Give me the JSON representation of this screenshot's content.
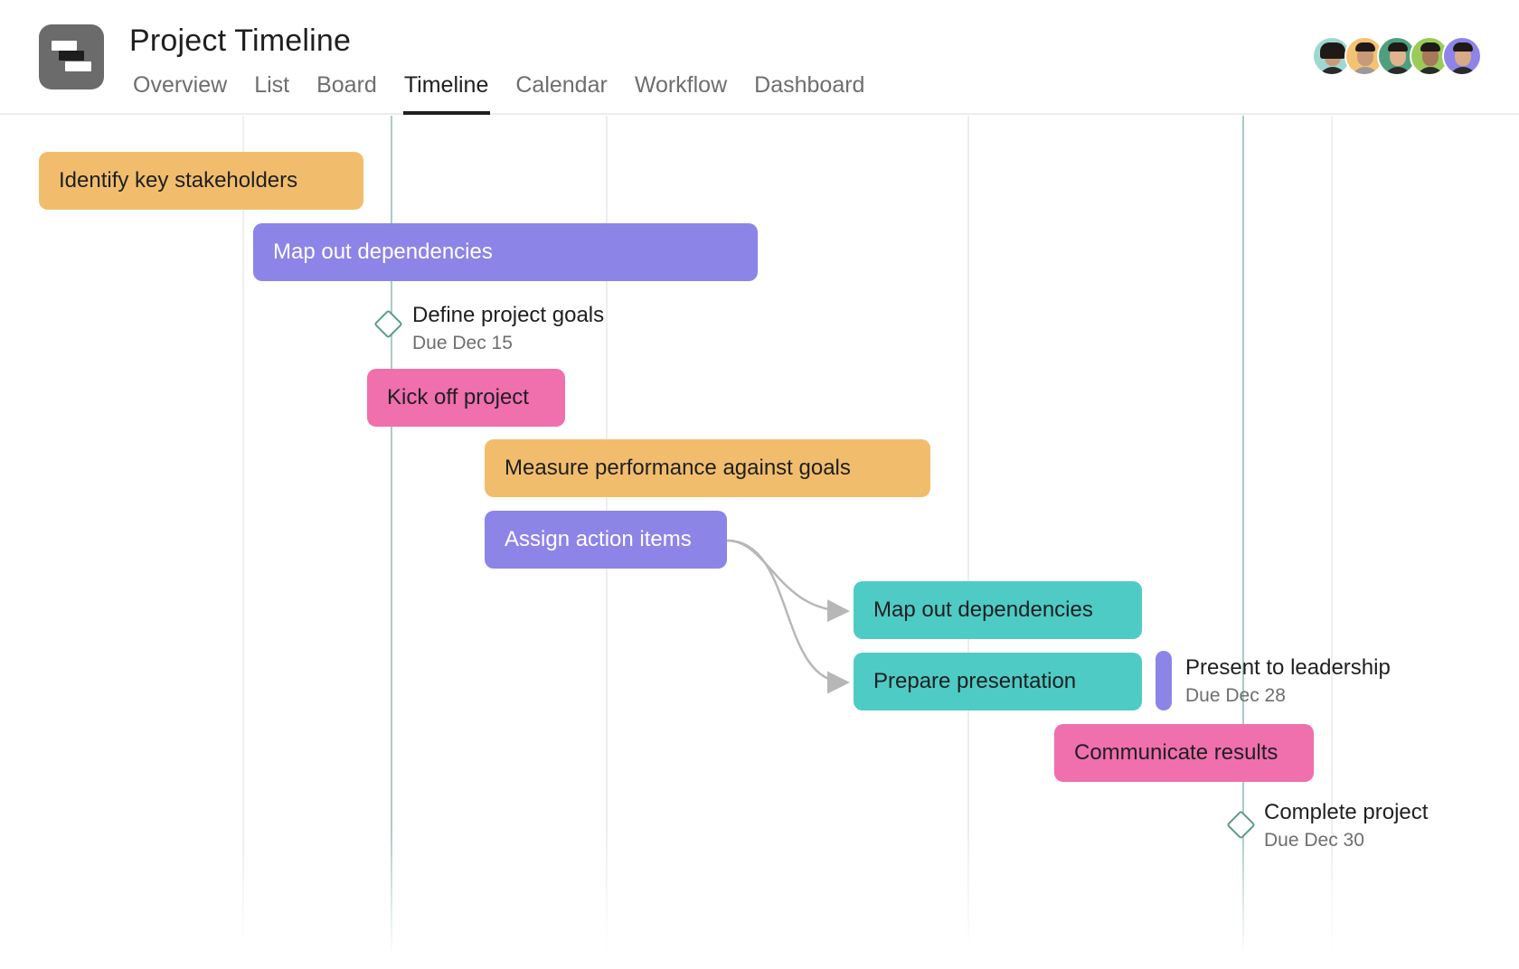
{
  "header": {
    "title": "Project Timeline",
    "logo_icon": "timeline-logo-icon",
    "tabs": [
      {
        "label": "Overview",
        "active": false
      },
      {
        "label": "List",
        "active": false
      },
      {
        "label": "Board",
        "active": false
      },
      {
        "label": "Timeline",
        "active": true
      },
      {
        "label": "Calendar",
        "active": false
      },
      {
        "label": "Workflow",
        "active": false
      },
      {
        "label": "Dashboard",
        "active": false
      }
    ],
    "members": [
      {
        "name": "member-1",
        "bg": "#9fd8d0"
      },
      {
        "name": "member-2",
        "bg": "#f3c272"
      },
      {
        "name": "member-3",
        "bg": "#4f9f7f"
      },
      {
        "name": "member-4",
        "bg": "#9acb5a"
      },
      {
        "name": "member-5",
        "bg": "#8e84e8"
      }
    ]
  },
  "colors": {
    "orange": "#f1bd6c",
    "purple": "#8d84e8",
    "pink": "#f06fad",
    "teal": "#4ecbc4",
    "milestone": "#5a9c85",
    "today_line": "#a9cdc3"
  },
  "tasks": [
    {
      "label": "Identify key stakeholders",
      "color": "orange"
    },
    {
      "label": "Map out dependencies",
      "color": "purple"
    },
    {
      "label": "Kick off project",
      "color": "pink"
    },
    {
      "label": "Measure performance against goals",
      "color": "orange"
    },
    {
      "label": "Assign action items",
      "color": "purple"
    },
    {
      "label": "Map out dependencies",
      "color": "teal"
    },
    {
      "label": "Prepare presentation",
      "color": "teal"
    },
    {
      "label": "Communicate results",
      "color": "pink"
    }
  ],
  "milestones": [
    {
      "title": "Define project goals",
      "due": "Due Dec 15"
    },
    {
      "title": "Present to leadership",
      "due": "Due Dec 28"
    },
    {
      "title": "Complete project",
      "due": "Due Dec 30"
    }
  ],
  "dependencies": [
    {
      "from": "Assign action items",
      "to": "Map out dependencies"
    },
    {
      "from": "Assign action items",
      "to": "Prepare presentation"
    }
  ]
}
